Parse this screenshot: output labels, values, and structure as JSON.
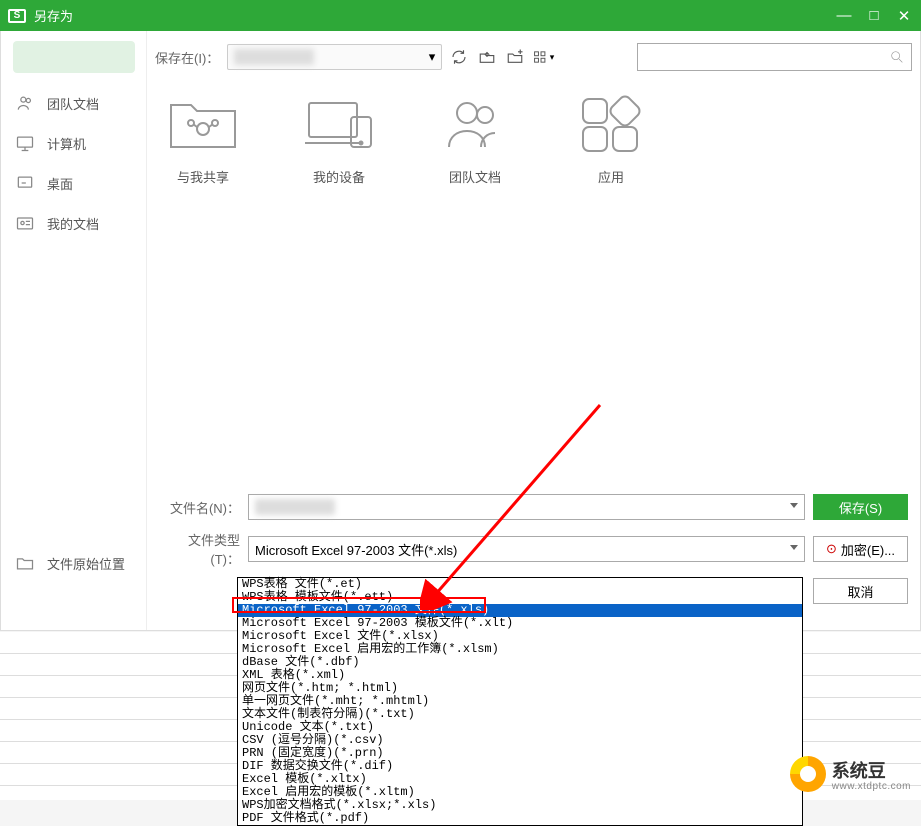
{
  "titlebar": {
    "title": "另存为"
  },
  "sidebar": {
    "items": [
      {
        "label": "团队文档",
        "icon": "team-icon"
      },
      {
        "label": "计算机",
        "icon": "computer-icon"
      },
      {
        "label": "桌面",
        "icon": "desktop-icon"
      },
      {
        "label": "我的文档",
        "icon": "documents-icon"
      },
      {
        "label": "文件原始位置",
        "icon": "folder-icon"
      }
    ]
  },
  "toolbar": {
    "location_label": "保存在(I)："
  },
  "folders": [
    {
      "label": "与我共享",
      "icon": "share-folder"
    },
    {
      "label": "我的设备",
      "icon": "devices-folder"
    },
    {
      "label": "团队文档",
      "icon": "team-folder"
    },
    {
      "label": "应用",
      "icon": "apps-folder"
    }
  ],
  "fields": {
    "filename_label": "文件名(N)：",
    "filetype_label": "文件类型(T)：",
    "filetype_value": "Microsoft Excel 97-2003 文件(*.xls)"
  },
  "buttons": {
    "save": "保存(S)",
    "encrypt": "加密(E)...",
    "cancel": "取消"
  },
  "filetype_options": [
    "WPS表格 文件(*.et)",
    "WPS表格 模板文件(*.ett)",
    "Microsoft Excel 97-2003 文件(*.xls)",
    "Microsoft Excel 97-2003 模板文件(*.xlt)",
    "Microsoft Excel 文件(*.xlsx)",
    "Microsoft Excel 启用宏的工作簿(*.xlsm)",
    "dBase 文件(*.dbf)",
    "XML 表格(*.xml)",
    "网页文件(*.htm; *.html)",
    "单一网页文件(*.mht; *.mhtml)",
    "文本文件(制表符分隔)(*.txt)",
    "Unicode 文本(*.txt)",
    "CSV (逗号分隔)(*.csv)",
    "PRN (固定宽度)(*.prn)",
    "DIF 数据交换文件(*.dif)",
    "Excel 模板(*.xltx)",
    "Excel 启用宏的模板(*.xltm)",
    "WPS加密文档格式(*.xlsx;*.xls)",
    "PDF 文件格式(*.pdf)"
  ],
  "selected_option_index": 2,
  "watermark": {
    "name": "系统豆",
    "url": "www.xtdptc.com"
  }
}
